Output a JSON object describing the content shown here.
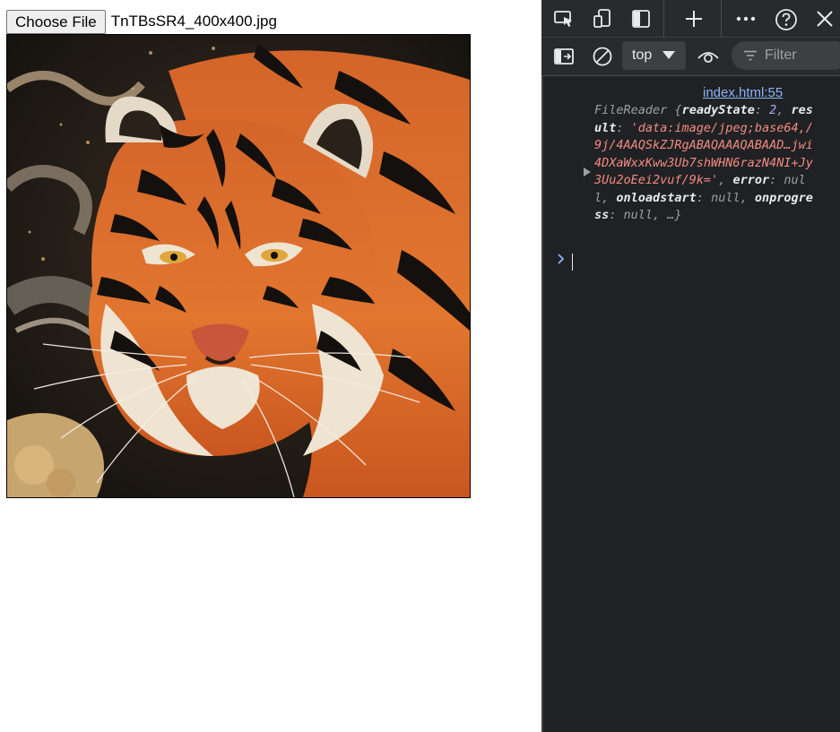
{
  "page": {
    "choose_file_label": "Choose File",
    "file_name": "TnTBsSR4_400x400.jpg",
    "preview_image": "tiger-illustration"
  },
  "devtools": {
    "toolbar_icons": [
      "inspect-element-icon",
      "device-emulation-icon",
      "dock-side-icon",
      "new-tab-plus-icon",
      "more-options-icon",
      "help-icon",
      "close-icon"
    ],
    "context_selector": "top",
    "filter_placeholder": "Filter",
    "console": {
      "source_link": "index.html:55",
      "entry": {
        "object_name": "FileReader",
        "open_brace": "{",
        "k1": "readyState",
        "v1": "2",
        "k2": "result",
        "v2": "'data:image/jpeg;base64,/9j/4AAQSkZJRgABAQAAAQABAAD…jwi4DXaWxxKww3Ub7shWHN6razN4NI+Jy3Uu2oEei2vuf/9k='",
        "k3": "error",
        "v3": "null",
        "k4": "onloadstart",
        "v4": "null",
        "k5": "onprogress",
        "v5": "null",
        "tail": ", …}"
      }
    },
    "colors": {
      "background": "#202124",
      "toolbar": "#292a2d",
      "link": "#8ab4f8",
      "key": "#e8eaed",
      "number": "#a5a8ff",
      "string": "#f28b82"
    }
  }
}
